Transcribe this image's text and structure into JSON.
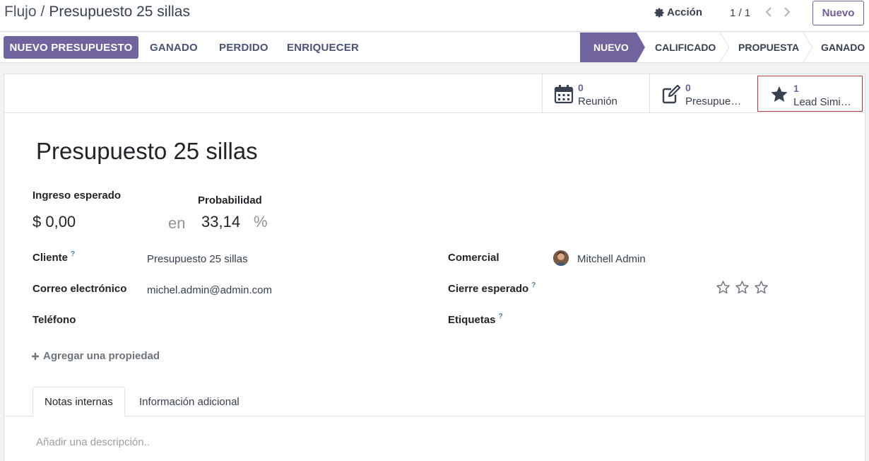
{
  "breadcrumb": {
    "parent": "Flujo",
    "separator": "/",
    "current": "Presupuesto 25 sillas"
  },
  "header": {
    "action_label": "Acción",
    "pager": "1 / 1",
    "new_label": "Nuevo"
  },
  "statusbar": {
    "primary_button": "NUEVO PRESUPUESTO",
    "buttons": [
      "GANADO",
      "PERDIDO",
      "ENRIQUECER"
    ],
    "stages": [
      "NUEVO",
      "CALIFICADO",
      "PROPUESTA",
      "GANADO"
    ],
    "active_stage": "NUEVO",
    "accent": "#71639e"
  },
  "smart_buttons": [
    {
      "value": "0",
      "label": "Reunión",
      "icon": "calendar-icon"
    },
    {
      "value": "0",
      "label": "Presupue…",
      "icon": "edit-icon"
    },
    {
      "value": "1",
      "label": "Lead Simi…",
      "icon": "star-icon"
    }
  ],
  "record": {
    "title": "Presupuesto 25 sillas",
    "expected_revenue_label": "Ingreso esperado",
    "expected_revenue": "$ 0,00",
    "in_word": "en",
    "probability_label": "Probabilidad",
    "probability": "33,14",
    "percent": "%",
    "customer_label": "Cliente",
    "customer": "Presupuesto 25 sillas",
    "email_label": "Correo electrónico",
    "email": "michel.admin@admin.com",
    "phone_label": "Teléfono",
    "salesperson_label": "Comercial",
    "salesperson": "Mitchell Admin",
    "expected_close_label": "Cierre esperado",
    "tags_label": "Etiquetas",
    "help_mark": "?",
    "priority_stars": 0,
    "add_property": "Agregar una propiedad"
  },
  "tabs": [
    "Notas internas",
    "Información adicional"
  ],
  "notes_placeholder": "Añadir una descripción.."
}
